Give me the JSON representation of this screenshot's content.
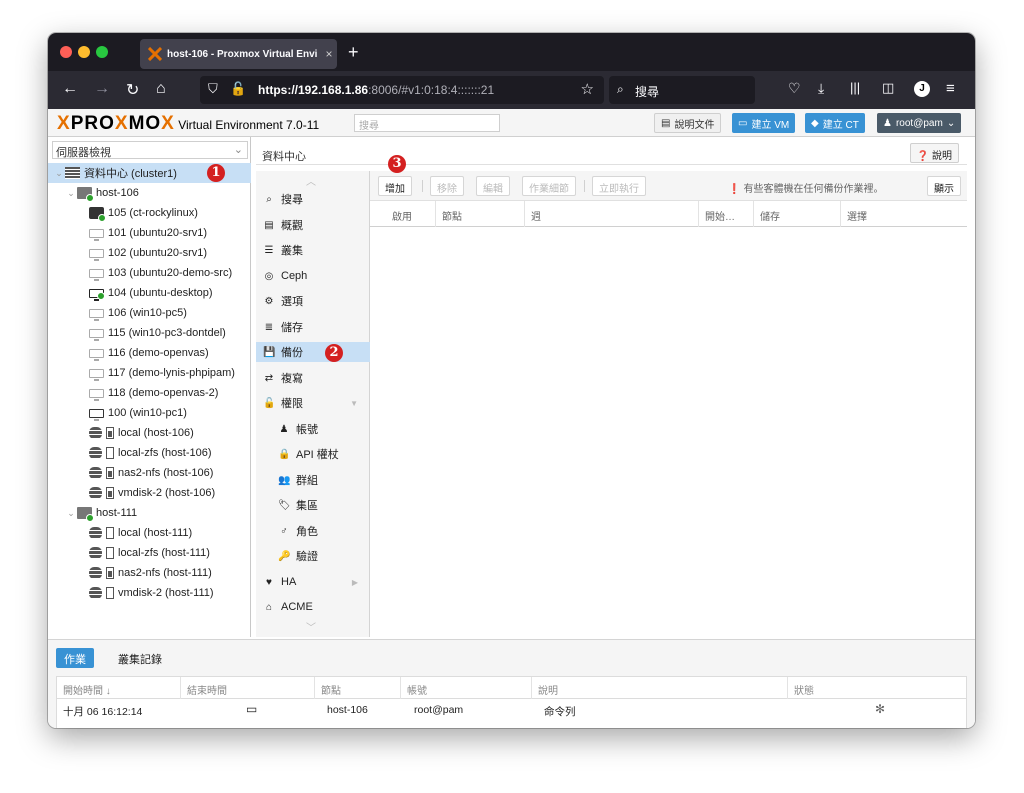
{
  "browser": {
    "tab_title": "host-106 - Proxmox Virtual Envi",
    "tab_close": "×",
    "new_tab": "+",
    "url_host": "https://192.168.1.86",
    "url_rest": ":8006/#v1:0:18:4:::::::21",
    "search_placeholder": "搜尋"
  },
  "pve_header": {
    "logo_pro": "PRO",
    "logo_x1": "X",
    "logo_mo": "MO",
    "logo_x2": "X",
    "version": " Virtual Environment 7.0-11",
    "search_placeholder": "搜尋",
    "docs_button": "說明文件",
    "create_vm_button": "建立 VM",
    "create_ct_button": "建立 CT",
    "user_menu": "root@pam"
  },
  "tree": {
    "view_select": "伺服器檢視",
    "items": [
      {
        "label": "資料中心 (cluster1)"
      },
      {
        "label": "host-106"
      },
      {
        "label": "105 (ct-rockylinux)"
      },
      {
        "label": "101 (ubuntu20-srv1)"
      },
      {
        "label": "102 (ubuntu20-srv1)"
      },
      {
        "label": "103 (ubuntu20-demo-src)"
      },
      {
        "label": "104 (ubuntu-desktop)"
      },
      {
        "label": "106 (win10-pc5)"
      },
      {
        "label": "115 (win10-pc3-dontdel)"
      },
      {
        "label": "116 (demo-openvas)"
      },
      {
        "label": "117 (demo-lynis-phpipam)"
      },
      {
        "label": "118 (demo-openvas-2)"
      },
      {
        "label": "100 (win10-pc1)"
      },
      {
        "label": "local (host-106)"
      },
      {
        "label": "local-zfs (host-106)"
      },
      {
        "label": "nas2-nfs (host-106)"
      },
      {
        "label": "vmdisk-2 (host-106)"
      },
      {
        "label": "host-111"
      },
      {
        "label": "local (host-111)"
      },
      {
        "label": "local-zfs (host-111)"
      },
      {
        "label": "nas2-nfs (host-111)"
      },
      {
        "label": "vmdisk-2 (host-111)"
      }
    ]
  },
  "content": {
    "breadcrumb": "資料中心",
    "help_button": "說明"
  },
  "menu": {
    "items": [
      {
        "label": "搜尋"
      },
      {
        "label": "概觀"
      },
      {
        "label": "叢集"
      },
      {
        "label": "Ceph"
      },
      {
        "label": "選項"
      },
      {
        "label": "儲存"
      },
      {
        "label": "備份"
      },
      {
        "label": "複寫"
      },
      {
        "label": "權限"
      },
      {
        "label": "帳號"
      },
      {
        "label": "API 權杖"
      },
      {
        "label": "群組"
      },
      {
        "label": "集區"
      },
      {
        "label": "角色"
      },
      {
        "label": "驗證"
      },
      {
        "label": "HA"
      },
      {
        "label": "ACME"
      }
    ]
  },
  "toolbar": {
    "add": "增加",
    "remove": "移除",
    "edit": "編輯",
    "job_detail": "作業細節",
    "run_now": "立即執行",
    "info": "有些客體機在任何備份作業裡。",
    "show": "顯示"
  },
  "grid": {
    "columns": [
      "啟用",
      "節點",
      "週",
      "開始…",
      "儲存",
      "選擇"
    ]
  },
  "bottom": {
    "tabs": [
      "作業",
      "叢集記錄"
    ],
    "columns": [
      "開始時間 ↓",
      "結束時間",
      "節點",
      "帳號",
      "說明",
      "狀態"
    ],
    "row": {
      "start": "十月 06 16:12:14",
      "end": "",
      "node": "host-106",
      "user": "root@pam",
      "desc": "命令列"
    }
  },
  "annotations": [
    "1",
    "2",
    "3"
  ],
  "colors": {
    "accent": "#3892d4",
    "selected": "#c7dff5",
    "badge": "#d42020",
    "logo_x": "#e57000"
  }
}
